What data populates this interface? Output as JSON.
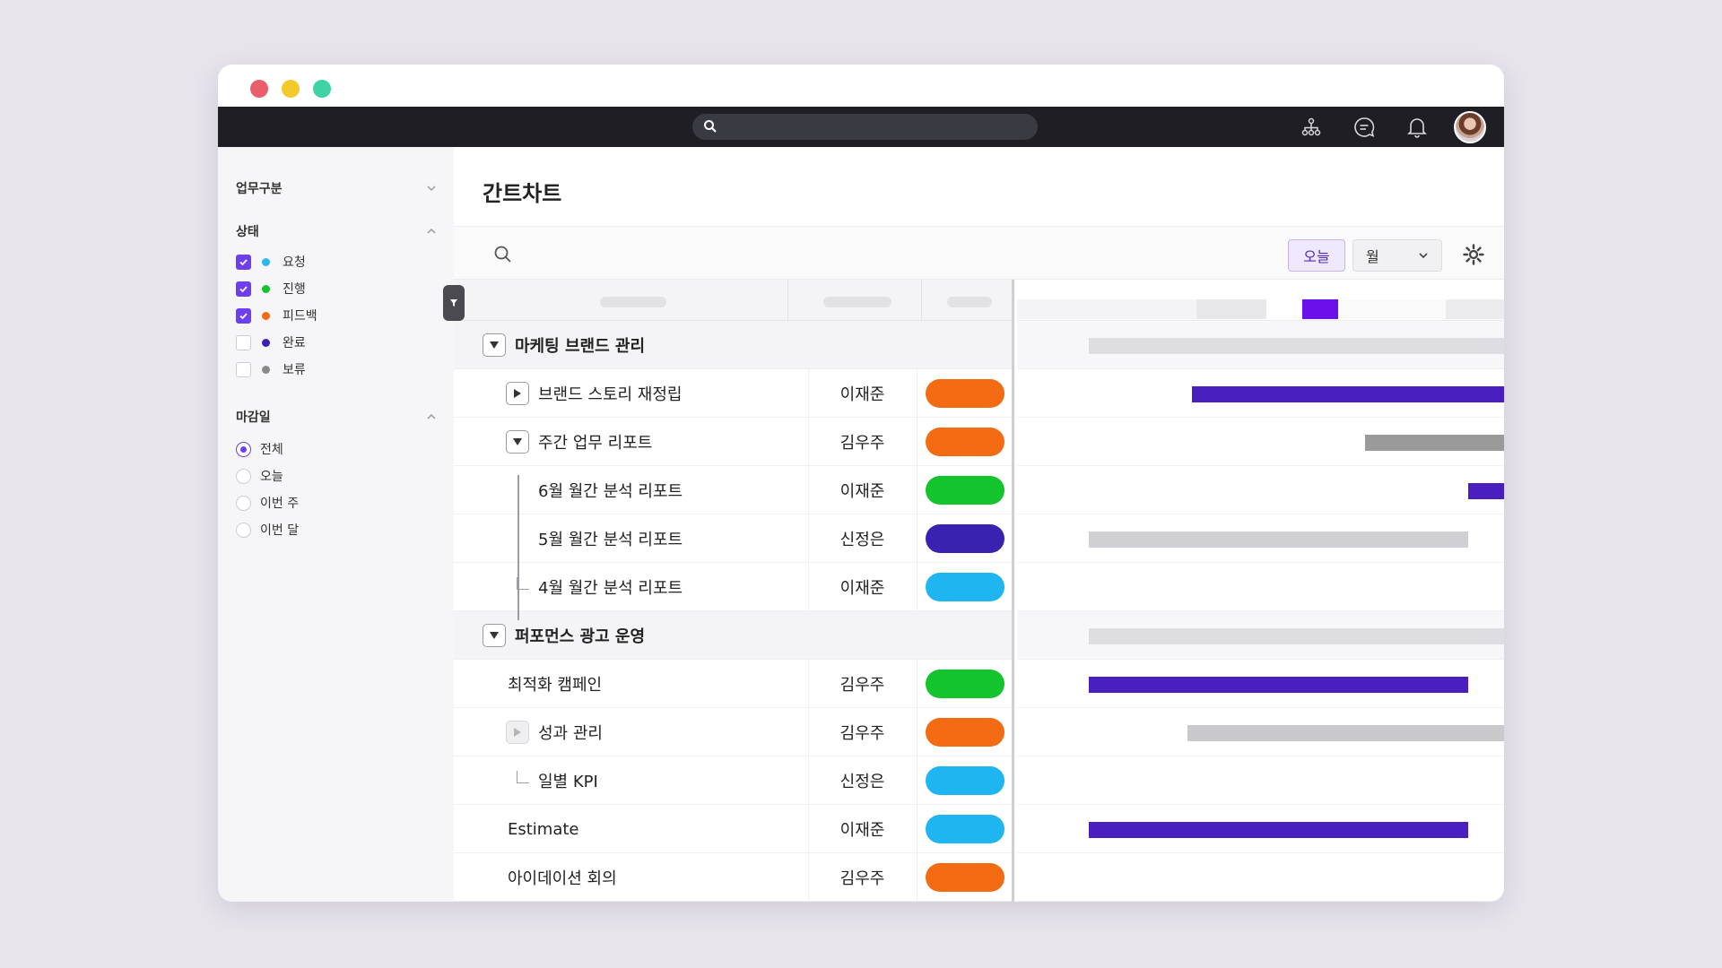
{
  "topbar": {
    "search_icon": "search-icon",
    "icons": [
      "org-chart-icon",
      "chat-icon",
      "bell-icon"
    ]
  },
  "sidebar": {
    "sections": {
      "work_type": {
        "title": "업무구분",
        "expanded": false
      },
      "status": {
        "title": "상태",
        "expanded": true
      },
      "deadline": {
        "title": "마감일",
        "expanded": true
      }
    },
    "status_options": [
      {
        "label": "요청",
        "checked": true,
        "color": "#2bb8f0"
      },
      {
        "label": "진행",
        "checked": true,
        "color": "#13c42c"
      },
      {
        "label": "피드백",
        "checked": true,
        "color": "#f36b12"
      },
      {
        "label": "완료",
        "checked": false,
        "color": "#3a22b0"
      },
      {
        "label": "보류",
        "checked": false,
        "color": "#8a8a8a"
      }
    ],
    "deadline_options": [
      {
        "label": "전체",
        "selected": true
      },
      {
        "label": "오늘",
        "selected": false
      },
      {
        "label": "이번 주",
        "selected": false
      },
      {
        "label": "이번 달",
        "selected": false
      }
    ]
  },
  "main": {
    "title": "간트차트",
    "today_label": "오늘",
    "view_select": "월"
  },
  "colors": {
    "accent": "#6d3ff0",
    "status_request": "#1eb5f0",
    "status_progress": "#13c42c",
    "status_feedback": "#f36b12",
    "status_done": "#3a22b0",
    "bar_purple": "#4a1fc0",
    "bar_gray": "#9a9a9a",
    "bar_light": "#dedee2"
  },
  "rows": [
    {
      "name": "마케팅 브랜드 관리",
      "group": true,
      "toggle": "expanded",
      "indent": 0
    },
    {
      "name": "브랜드 스토리 재정립",
      "assignee": "이재준",
      "status": "#f36b12",
      "toggle": "collapsed",
      "indent": 1
    },
    {
      "name": "주간 업무 리포트",
      "assignee": "김우주",
      "status": "#f36b12",
      "toggle": "expanded",
      "indent": 1
    },
    {
      "name": "6월 월간 분석 리포트",
      "assignee": "이재준",
      "status": "#13c42c",
      "indent": 2
    },
    {
      "name": "5월 월간 분석 리포트",
      "assignee": "신정은",
      "status": "#3a22b0",
      "indent": 2
    },
    {
      "name": "4월 월간 분석 리포트",
      "assignee": "이재준",
      "status": "#1eb5f0",
      "indent": 2,
      "branch": true
    },
    {
      "name": "퍼포먼스 광고 운영",
      "group": true,
      "toggle": "expanded",
      "indent": 0
    },
    {
      "name": "최적화 캠페인",
      "assignee": "김우주",
      "status": "#13c42c",
      "indent": 1
    },
    {
      "name": "성과 관리",
      "assignee": "김우주",
      "status": "#f36b12",
      "toggle": "disabled",
      "indent": 1
    },
    {
      "name": "일별 KPI",
      "assignee": "신정은",
      "status": "#1eb5f0",
      "indent": 2,
      "branch": true
    },
    {
      "name": "Estimate",
      "assignee": "이재준",
      "status": "#1eb5f0",
      "indent": 1
    },
    {
      "name": "아이데이션 회의",
      "assignee": "김우주",
      "status": "#f36b12",
      "indent": 1
    }
  ]
}
